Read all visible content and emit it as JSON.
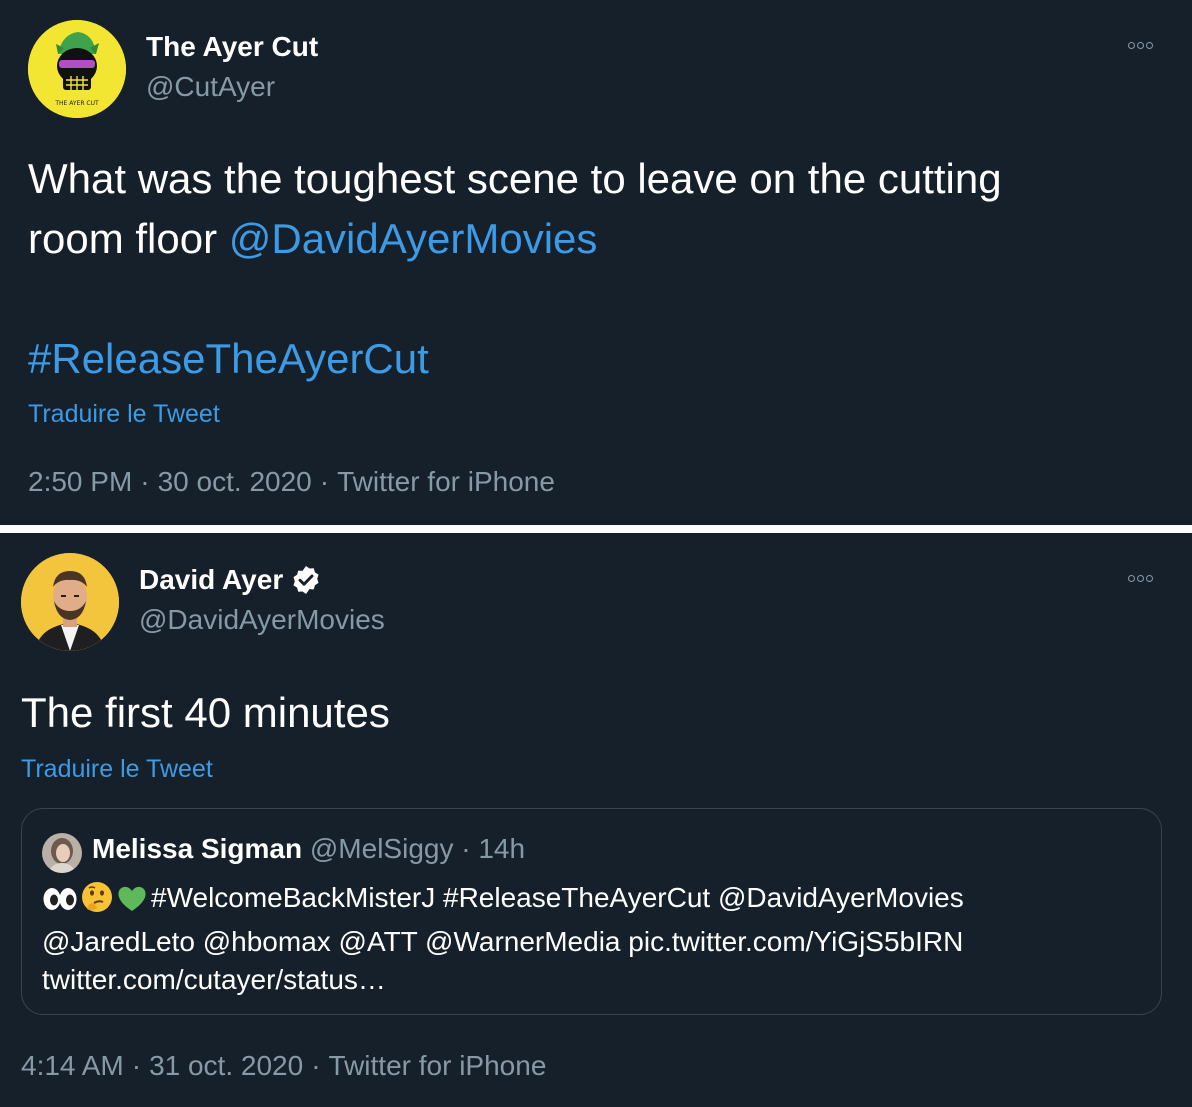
{
  "tweet1": {
    "author_name": "The Ayer Cut",
    "author_handle": "@CutAyer",
    "avatar_text": "THE AYER CUT",
    "text_line1": "What was the toughest scene to leave on the cutting",
    "text_line2_plain": "room floor ",
    "mention": "@DavidAyerMovies",
    "hashtag": "#ReleaseTheAyerCut",
    "translate_label": "Traduire le Tweet",
    "time": "2:50 PM",
    "date": "30 oct. 2020",
    "source": "Twitter for iPhone",
    "separator": "·",
    "avatar_color": "#f2e632"
  },
  "tweet2": {
    "author_name": "David Ayer",
    "verified": true,
    "author_handle": "@DavidAyerMovies",
    "text": "The first 40 minutes",
    "translate_label": "Traduire le Tweet",
    "time": "4:14 AM",
    "date": "31 oct. 2020",
    "source": "Twitter for iPhone",
    "separator": "·",
    "avatar_color": "#f2c53d",
    "quoted": {
      "author_name": "Melissa Sigman",
      "author_handle": "@MelSiggy",
      "separator": "·",
      "age": "14h",
      "emojis": [
        "eyes-emoji",
        "thinking-face-emoji",
        "green-heart-emoji"
      ],
      "line1": "#WelcomeBackMisterJ #ReleaseTheAyerCut @DavidAyerMovies",
      "line2": "@JaredLeto @hbomax @ATT @WarnerMedia pic.twitter.com/YiGjS5bIRN",
      "line3": "twitter.com/cutayer/status…"
    }
  },
  "colors": {
    "background": "#15202b",
    "text": "#ffffff",
    "secondary_text": "#8899a6",
    "link": "#3d9ae5",
    "border": "#38444d",
    "green_heart": "#5fb85a"
  }
}
